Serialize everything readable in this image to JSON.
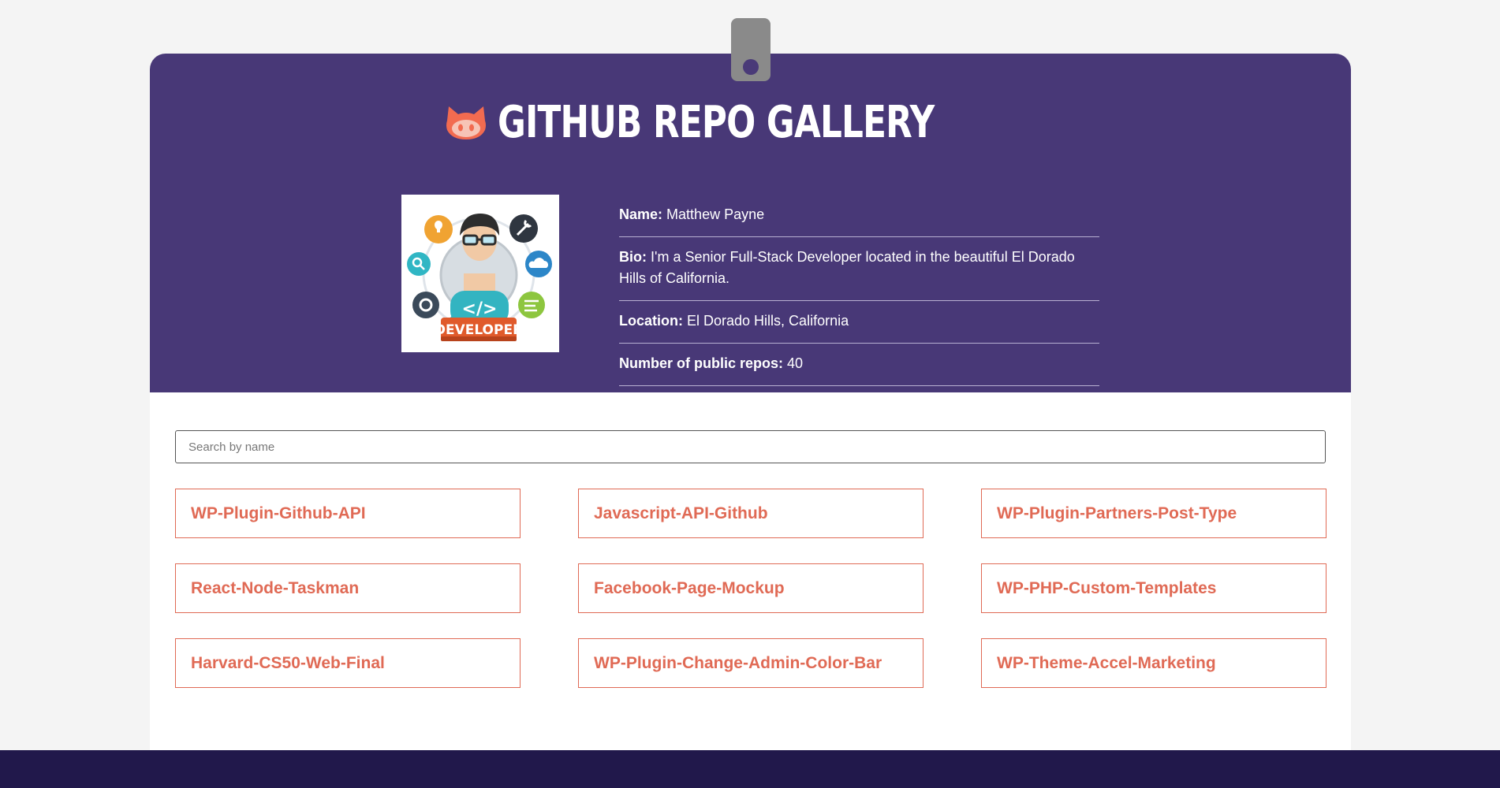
{
  "header": {
    "title": "GITHUB REPO GALLERY",
    "accent_color": "#f26b50",
    "background_color": "#483877"
  },
  "profile": {
    "avatar_label": "DEVELOPER",
    "name_label": "Name:",
    "name": "Matthew Payne",
    "bio_label": "Bio:",
    "bio": "I'm a Senior Full-Stack Developer located in the beautiful El Dorado Hills of California.",
    "location_label": "Location:",
    "location": "El Dorado Hills, California",
    "repos_label": "Number of public repos:",
    "repos_count": "40"
  },
  "search": {
    "placeholder": "Search by name"
  },
  "repos": [
    {
      "name": "WP-Plugin-Github-API"
    },
    {
      "name": "Javascript-API-Github"
    },
    {
      "name": "WP-Plugin-Partners-Post-Type"
    },
    {
      "name": "React-Node-Taskman"
    },
    {
      "name": "Facebook-Page-Mockup"
    },
    {
      "name": "WP-PHP-Custom-Templates"
    },
    {
      "name": "Harvard-CS50-Web-Final"
    },
    {
      "name": "WP-Plugin-Change-Admin-Color-Bar"
    },
    {
      "name": "WP-Theme-Accel-Marketing"
    }
  ],
  "icons": {
    "title_icon": "github-octocat-icon",
    "badge": "badge-clip-icon"
  },
  "footer": {
    "background_color": "#21184b"
  }
}
